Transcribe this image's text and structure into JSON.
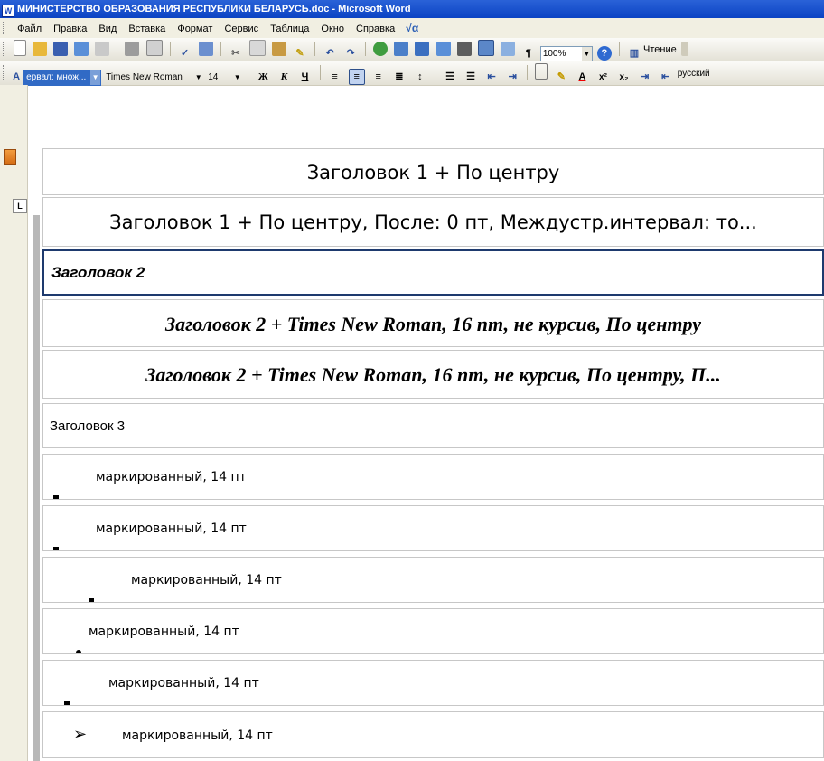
{
  "window": {
    "title": "МИНИСТЕРСТВО ОБРАЗОВАНИЯ РЕСПУБЛИКИ БЕЛАРУСЬ.doc - Microsoft Word",
    "app_icon": "W"
  },
  "menu": {
    "items": [
      "Файл",
      "Правка",
      "Вид",
      "Вставка",
      "Формат",
      "Сервис",
      "Таблица",
      "Окно",
      "Справка"
    ],
    "equation_icon": "√α"
  },
  "toolbar_standard": {
    "zoom": "100%",
    "reading_label": "Чтение"
  },
  "toolbar_formatting": {
    "style_combo": "ервал: множ...",
    "font_combo": "Times New Roman",
    "size_combo": "14",
    "bold": "Ж",
    "italic": "К",
    "underline": "Ч",
    "language": "русский"
  },
  "style_list": [
    {
      "text": "Заголовок 1 + По центру"
    },
    {
      "text": "Заголовок 1 + По центру, После:  0 пт, Междустр.интервал:  то..."
    },
    {
      "text": "Заголовок 2"
    },
    {
      "text": "Заголовок 2 + Times New Roman, 16 пт, не курсив, По центру"
    },
    {
      "text": "Заголовок 2 + Times New Roman, 16 пт, не курсив, По центру, П..."
    },
    {
      "text": "Заголовок 3"
    },
    {
      "text": "маркированный, 14 пт"
    },
    {
      "text": "маркированный, 14 пт"
    },
    {
      "text": "маркированный, 14 пт"
    },
    {
      "text": "маркированный, 14 пт"
    },
    {
      "text": "маркированный, 14 пт"
    },
    {
      "text": "маркированный, 14 пт"
    }
  ],
  "colors": {
    "titlebar": "#0b43c4",
    "selected_border": "#1e3a6e",
    "slide_accent": "#8fb82a"
  }
}
